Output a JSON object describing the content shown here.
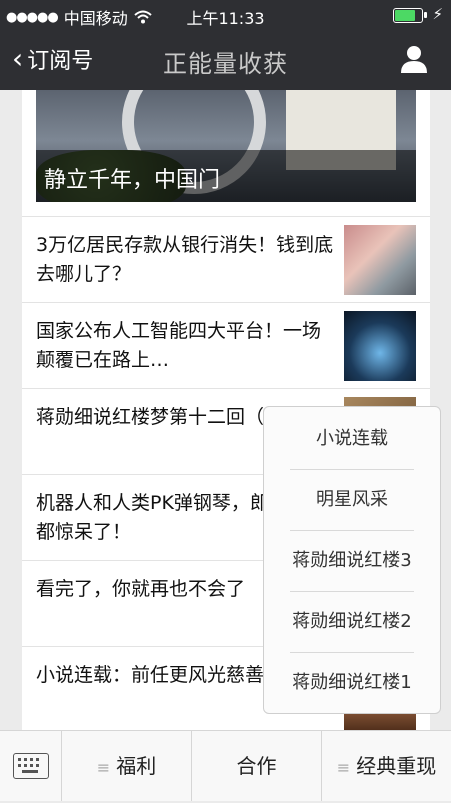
{
  "status_bar": {
    "carrier": "中国移动",
    "signal_dots": "●●●●●",
    "time": "上午11:33",
    "battery_level": 0.85
  },
  "nav": {
    "back_label": "订阅号",
    "title": "正能量收获"
  },
  "hero": {
    "caption": "静立千年，中国门"
  },
  "articles": [
    {
      "title": "3万亿居民存款从银行消失！钱到底去哪儿了？"
    },
    {
      "title": "国家公布人工智能四大平台！一场颠覆已在路上…"
    },
    {
      "title": "蒋勋细说红楼梦第十二回（下）3"
    },
    {
      "title": "机器人和人类PK弹钢琴，郎朗现场都惊呆了！"
    },
    {
      "title": "看完了，你就再也不会了"
    },
    {
      "title": "小说连载：前任更风光慈善拍卖会"
    }
  ],
  "popup_menu": {
    "items": [
      "小说连载",
      "明星风采",
      "蒋勋细说红楼3",
      "蒋勋细说红楼2",
      "蒋勋细说红楼1"
    ]
  },
  "bottom_menu": {
    "tabs": [
      "福利",
      "合作",
      "经典重现"
    ]
  }
}
